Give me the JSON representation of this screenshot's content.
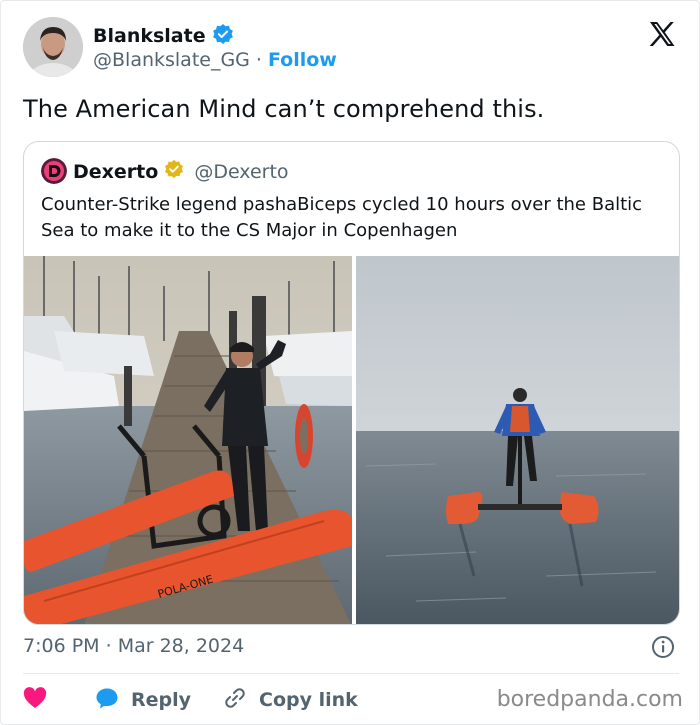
{
  "author": {
    "display_name": "Blankslate",
    "handle": "@Blankslate_GG",
    "separator": "·",
    "follow_label": "Follow",
    "verified_color": "#1d9bf0"
  },
  "platform_icon": "x-logo-icon",
  "tweet": {
    "text": "The American Mind can’t comprehend this."
  },
  "quoted": {
    "display_name": "Dexerto",
    "handle": "@Dexerto",
    "verified_color": "#e2b719",
    "text": "Counter-Strike legend pashaBiceps cycled 10 hours over the Baltic Sea to make it to the CS Major in Copenhagen",
    "photos": [
      {
        "icon": "photo-marina-water-bike"
      },
      {
        "icon": "photo-open-sea-water-bike"
      }
    ],
    "photo_label": "POLA-ONE"
  },
  "meta": {
    "time": "7:06 PM",
    "separator": "·",
    "date": "Mar 28, 2024"
  },
  "actions": {
    "reply_label": "Reply",
    "copy_link_label": "Copy link"
  },
  "colors": {
    "accent": "#1d9bf0",
    "heart": "#f91880",
    "text": "#0f1419",
    "muted": "#536471"
  },
  "watermark": "boredpanda.com"
}
